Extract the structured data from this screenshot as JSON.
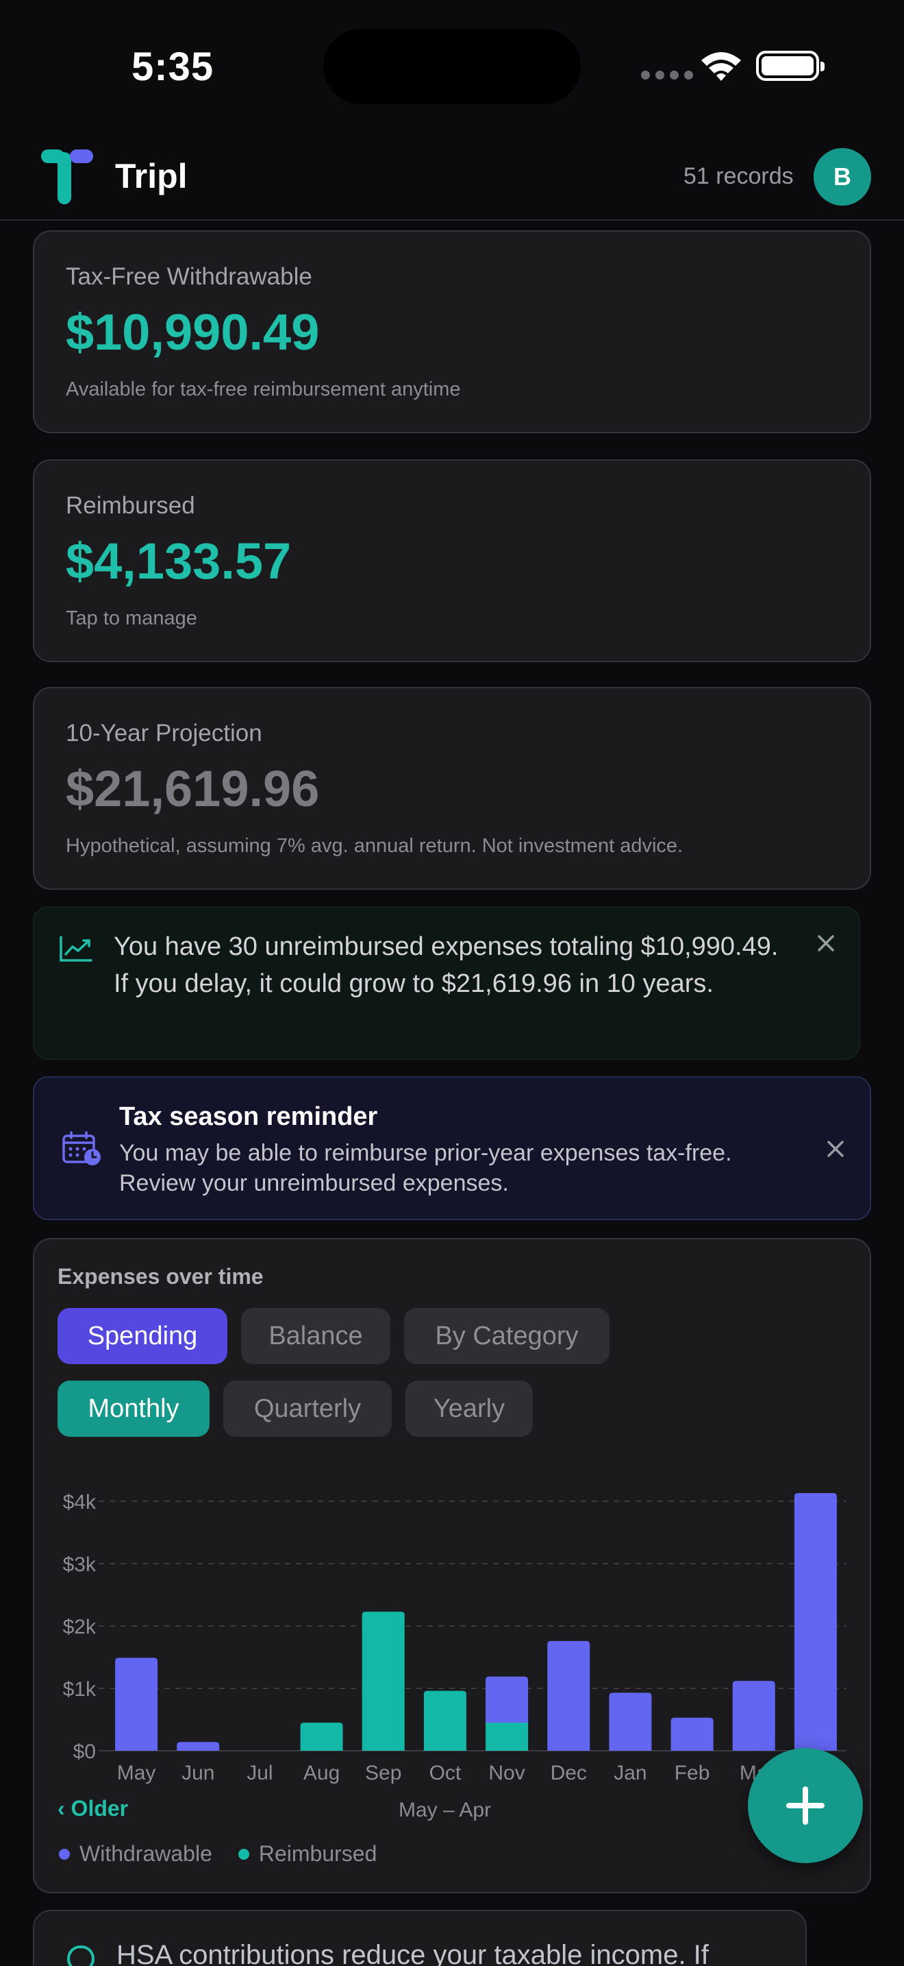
{
  "status_bar": {
    "time": "5:35"
  },
  "header": {
    "app_name": "Tripl",
    "records": "51 records",
    "avatar_initial": "B"
  },
  "cards": {
    "withdrawable": {
      "label": "Tax-Free Withdrawable",
      "value": "$10,990.49",
      "sub": "Available for tax-free reimbursement anytime"
    },
    "reimbursed": {
      "label": "Reimbursed",
      "value": "$4,133.57",
      "sub": "Tap to manage"
    },
    "projection": {
      "label": "10-Year Projection",
      "value": "$21,619.96",
      "sub": "Hypothetical, assuming 7% avg. annual return. Not investment advice."
    }
  },
  "growth_banner": {
    "text": "You have 30 unreimbursed expenses totaling $10,990.49. If you delay, it could grow to $21,619.96 in 10 years.",
    "icon": "trend-up-icon"
  },
  "tax_banner": {
    "title": "Tax season reminder",
    "text": "You may be able to reimburse prior-year expenses tax-free. Review your unreimbursed expenses.",
    "icon": "calendar-clock-icon"
  },
  "chart_section": {
    "title": "Expenses over time",
    "view_tabs": [
      "Spending",
      "Balance",
      "By Category"
    ],
    "period_tabs": [
      "Monthly",
      "Quarterly",
      "Yearly"
    ],
    "older_label": "Older",
    "range_label": "May – Apr",
    "legend": [
      "Withdrawable",
      "Reimbursed"
    ]
  },
  "colors": {
    "withdrawable": "#6366f1",
    "reimbursed": "#14b8a6",
    "accent": "#1fbfa9"
  },
  "chart_data": {
    "type": "bar",
    "stacked": true,
    "categories": [
      "May",
      "Jun",
      "Jul",
      "Aug",
      "Sep",
      "Oct",
      "Nov",
      "Dec",
      "Jan",
      "Feb",
      "Mar",
      "Apr"
    ],
    "x_tick_labels": [
      "May",
      "Jun",
      "Jul",
      "Aug",
      "Sep",
      "Oct",
      "Nov",
      "Dec",
      "Jan",
      "Feb",
      "Ma",
      ""
    ],
    "series": [
      {
        "name": "Reimbursed",
        "values": [
          0,
          0,
          0,
          450,
          2230,
          960,
          450,
          0,
          0,
          0,
          0,
          0
        ]
      },
      {
        "name": "Withdrawable",
        "values": [
          1490,
          140,
          0,
          0,
          0,
          0,
          740,
          1760,
          930,
          530,
          1120,
          4130
        ]
      }
    ],
    "y_ticks": [
      "$0",
      "$1k",
      "$2k",
      "$3k",
      "$4k"
    ],
    "ylim": [
      0,
      4000
    ],
    "grid": true,
    "legend_position": "bottom-left"
  },
  "tip": {
    "text": "HSA contributions reduce your taxable income. If",
    "icon": "lightbulb-icon"
  }
}
